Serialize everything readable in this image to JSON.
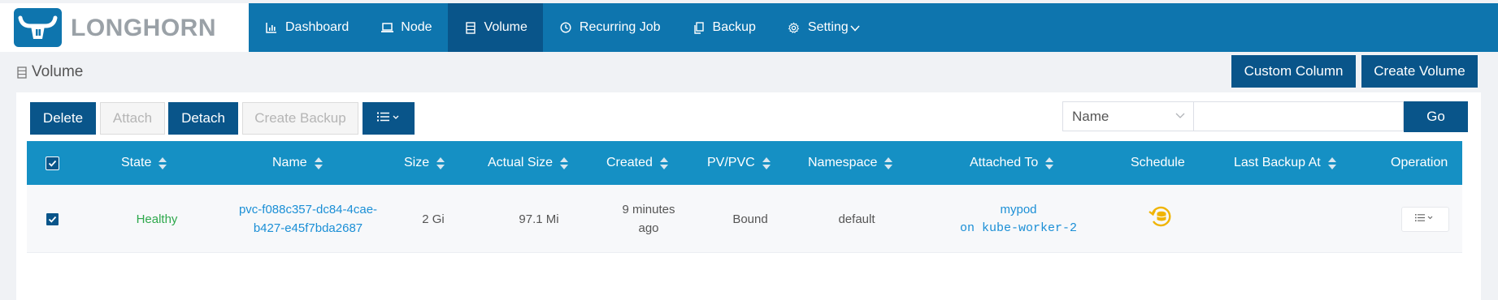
{
  "brand": {
    "name": "LONGHORN"
  },
  "nav": [
    {
      "label": "Dashboard",
      "icon": "bar-chart-icon"
    },
    {
      "label": "Node",
      "icon": "laptop-icon"
    },
    {
      "label": "Volume",
      "icon": "database-icon",
      "active": true
    },
    {
      "label": "Recurring Job",
      "icon": "clock-icon"
    },
    {
      "label": "Backup",
      "icon": "copy-icon"
    },
    {
      "label": "Setting",
      "icon": "gear-icon"
    }
  ],
  "page": {
    "title": "Volume",
    "custom_column_label": "Custom Column",
    "create_volume_label": "Create Volume"
  },
  "toolbar": {
    "delete_label": "Delete",
    "attach_label": "Attach",
    "detach_label": "Detach",
    "create_backup_label": "Create Backup"
  },
  "search": {
    "field_value": "Name",
    "query": "",
    "go_label": "Go"
  },
  "table": {
    "columns": [
      "State",
      "Name",
      "Size",
      "Actual Size",
      "Created",
      "PV/PVC",
      "Namespace",
      "Attached To",
      "Schedule",
      "Last Backup At",
      "Operation"
    ],
    "rows": [
      {
        "checked": true,
        "state": "Healthy",
        "name_line1": "pvc-f088c357-dc84-4cae-",
        "name_line2": "b427-e45f7bda2687",
        "size": "2 Gi",
        "actual_size": "97.1 Mi",
        "created_line1": "9 minutes",
        "created_line2": "ago",
        "pv_pvc": "Bound",
        "namespace": "default",
        "attached_pod": "mypod",
        "attached_node": "on kube-worker-2",
        "last_backup_at": ""
      }
    ]
  },
  "colors": {
    "primary": "#0e75ae",
    "dark": "#09558a",
    "table_header": "#1590c4",
    "healthy": "#2ea84c",
    "link": "#1b8fd6",
    "schedule": "#f0b400"
  }
}
